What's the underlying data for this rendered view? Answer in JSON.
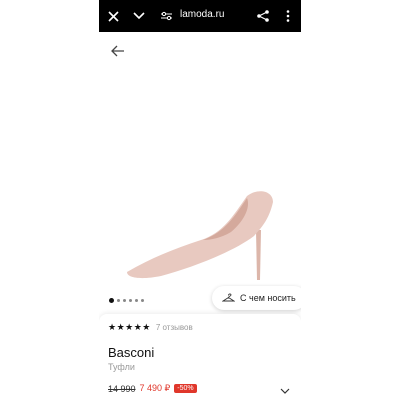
{
  "browser": {
    "url": "lamoda.ru",
    "icons": [
      "close-icon",
      "chevron-down-icon",
      "tune-icon",
      "share-icon",
      "more-vertical-icon"
    ]
  },
  "page": {
    "back_icon": "arrow-left-icon"
  },
  "gallery": {
    "image": "beige pointed-toe stiletto pump",
    "dot_count": 6,
    "active_index": 0
  },
  "outfit_button": {
    "label": "С чем носить",
    "icon": "hanger-icon"
  },
  "product": {
    "rating_stars": 4.5,
    "reviews": "7 отзывов",
    "brand": "Basconi",
    "category": "Туфли",
    "old_price": "14 990",
    "new_price": "7 490 ₽",
    "discount": "-50%"
  },
  "colors": {
    "accent": "#e0372b",
    "shoe": "#e8c9c0",
    "bar": "#000000"
  }
}
